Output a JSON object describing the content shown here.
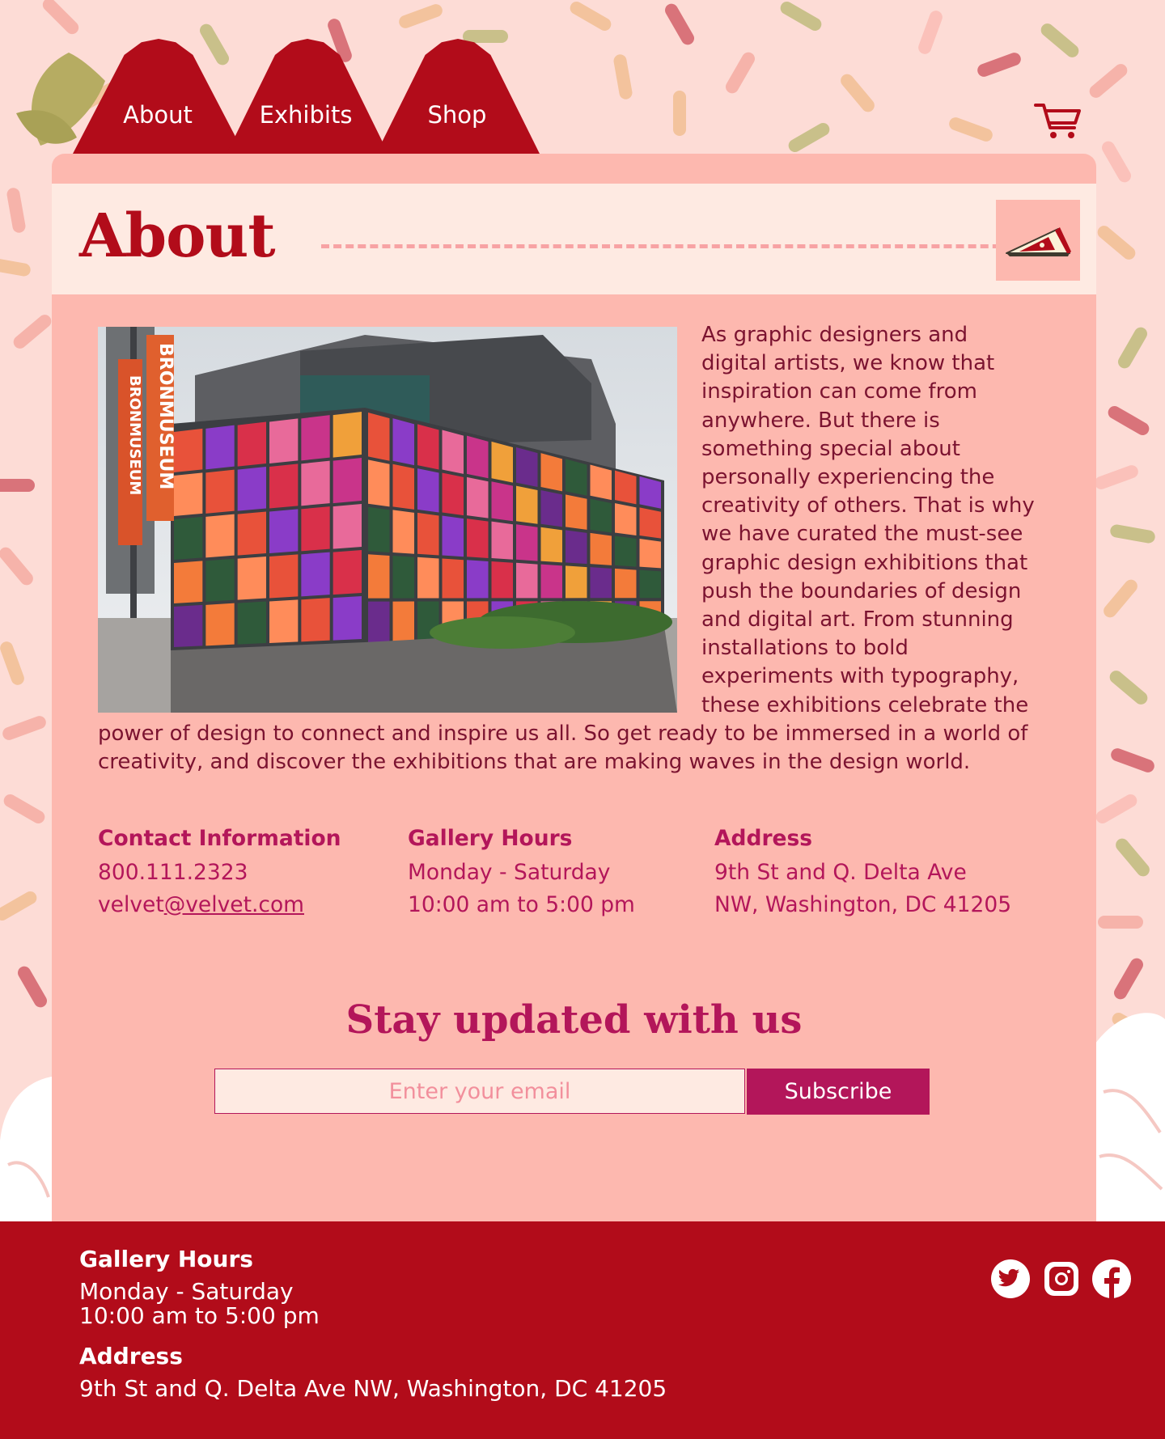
{
  "nav": {
    "items": [
      {
        "label": "About"
      },
      {
        "label": "Exhibits"
      },
      {
        "label": "Shop"
      }
    ],
    "cart_icon": "shopping-cart-icon"
  },
  "page": {
    "title": "About",
    "corner_icon": "pizza-slice-icon",
    "image_icon": "museum-building-photo",
    "about_text": "As graphic designers and digital artists, we know that inspiration can come from anywhere. But there is something special about personally experiencing the creativity of others. That is why we have curated the must-see graphic design exhibitions that push the boundaries of design and digital art. From stunning installations to bold experiments with typography, these exhibitions celebrate the power of design to connect and inspire us all. So get ready to be immersed in a world of creativity, and discover the exhibitions that are making waves in the design world."
  },
  "info": {
    "contact": {
      "heading": "Contact Information",
      "phone": "800.111.2323",
      "email_user": "velvet",
      "email_link": "@velvet.com"
    },
    "hours": {
      "heading": "Gallery Hours",
      "days": "Monday - Saturday",
      "time": "10:00 am to 5:00 pm"
    },
    "address": {
      "heading": "Address",
      "line1": "9th St and Q. Delta Ave",
      "line2": "NW, Washington, DC 41205"
    }
  },
  "subscribe": {
    "title": "Stay updated with us",
    "placeholder": "Enter your email",
    "button_label": "Subscribe"
  },
  "footer": {
    "hours_heading": "Gallery Hours",
    "hours_days": "Monday - Saturday",
    "hours_time": "10:00 am to 5:00 pm",
    "address_heading": "Address",
    "address_line": "9th St and Q. Delta Ave NW, Washington, DC 41205",
    "social": [
      "twitter-icon",
      "instagram-icon",
      "facebook-icon"
    ]
  },
  "colors": {
    "brand_red": "#b20c1a",
    "magenta": "#b3165a",
    "background": "#fddcd6",
    "card": "#fdb8af",
    "card_header": "#feeae2"
  }
}
